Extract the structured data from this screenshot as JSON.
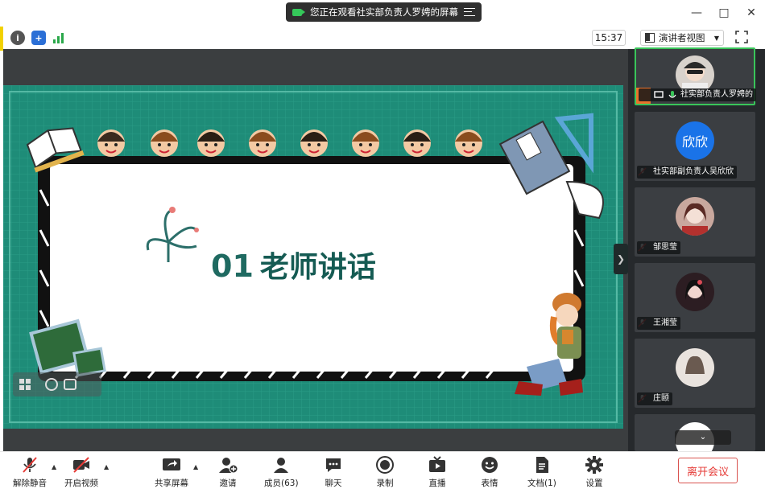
{
  "share_banner": {
    "text": "您正在观看社实部负责人罗娉的屏幕"
  },
  "status": {
    "time": "15:37",
    "view_mode": "演讲者视图"
  },
  "slide": {
    "number": "01",
    "title": "老师讲话"
  },
  "participants": [
    {
      "name": "社实部负责人罗娉的",
      "avatar_text": "",
      "active": true
    },
    {
      "name": "社实部副负责人吴欣欣",
      "avatar_text": "欣欣",
      "active": false
    },
    {
      "name": "邹思莹",
      "avatar_text": "",
      "active": false
    },
    {
      "name": "王湘莹",
      "avatar_text": "",
      "active": false
    },
    {
      "name": "庄颐",
      "avatar_text": "",
      "active": false
    }
  ],
  "toolbar": {
    "unmute": "解除静音",
    "start_video": "开启视频",
    "share": "共享屏幕",
    "invite": "邀请",
    "members": "成员(63)",
    "chat": "聊天",
    "record": "录制",
    "live": "直播",
    "reaction": "表情",
    "docs": "文档(1)",
    "settings": "设置",
    "leave": "离开会议"
  },
  "colors": {
    "accent_green": "#39c55a",
    "slide_teal": "#1e8c78",
    "leave_red": "#e53a36"
  }
}
